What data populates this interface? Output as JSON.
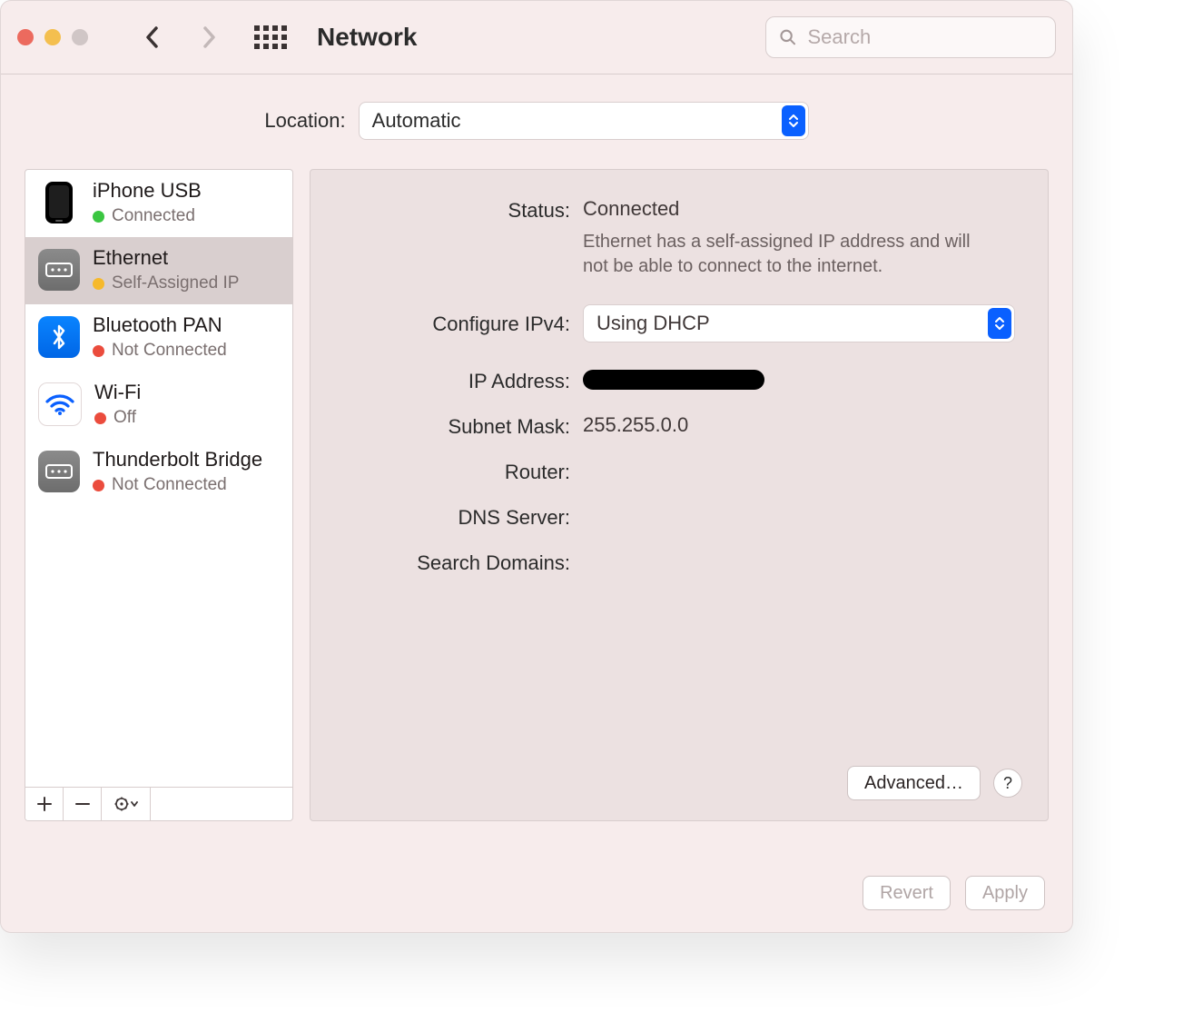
{
  "window": {
    "title": "Network"
  },
  "search": {
    "placeholder": "Search"
  },
  "location": {
    "label": "Location:",
    "value": "Automatic"
  },
  "services": [
    {
      "name": "iPhone USB",
      "status_label": "Connected",
      "status_color": "green",
      "icon": "phone",
      "selected": false
    },
    {
      "name": "Ethernet",
      "status_label": "Self-Assigned IP",
      "status_color": "yellow",
      "icon": "eth",
      "selected": true
    },
    {
      "name": "Bluetooth PAN",
      "status_label": "Not Connected",
      "status_color": "red",
      "icon": "bt",
      "selected": false
    },
    {
      "name": "Wi-Fi",
      "status_label": "Off",
      "status_color": "red",
      "icon": "wifi",
      "selected": false
    },
    {
      "name": "Thunderbolt Bridge",
      "status_label": "Not Connected",
      "status_color": "red",
      "icon": "tb",
      "selected": false
    }
  ],
  "detail": {
    "status_label": "Status:",
    "status_value": "Connected",
    "status_desc": "Ethernet has a self-assigned IP address and will not be able to connect to the internet.",
    "configure_label": "Configure IPv4:",
    "configure_value": "Using DHCP",
    "ip_label": "IP Address:",
    "subnet_label": "Subnet Mask:",
    "subnet_value": "255.255.0.0",
    "router_label": "Router:",
    "dns_label": "DNS Server:",
    "search_domains_label": "Search Domains:",
    "advanced_label": "Advanced…",
    "help_label": "?"
  },
  "footer": {
    "revert": "Revert",
    "apply": "Apply"
  }
}
